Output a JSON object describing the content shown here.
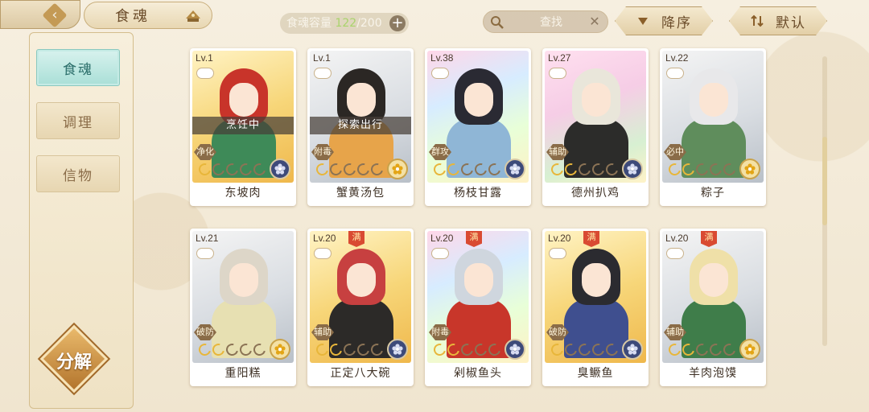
{
  "header": {
    "title": "食魂",
    "capacity_label": "食魂容量",
    "capacity_current": "122",
    "capacity_max": "/200",
    "search_placeholder": "查找",
    "sort_desc": "降序",
    "sort_default": "默认"
  },
  "sidebar": {
    "items": [
      {
        "label": "食魂",
        "active": true
      },
      {
        "label": "调理",
        "active": false
      },
      {
        "label": "信物",
        "active": false
      }
    ],
    "decompose_label": "分解"
  },
  "colors": {
    "accent": "#c49a55",
    "active_tab": "#a9dfd7",
    "status_overlay": "#463e37"
  },
  "cards": [
    {
      "level": "Lv.1",
      "name": "东坡肉",
      "role": "净化",
      "status": "烹饪中",
      "stars_on": 1,
      "badge": "blue",
      "frame": "gold",
      "hair": "#c8342a",
      "outfit": "#3e8a58",
      "ribbon": ""
    },
    {
      "level": "Lv.1",
      "name": "蟹黄汤包",
      "role": "附毒",
      "status": "探索出行",
      "stars_on": 1,
      "badge": "yellow",
      "frame": "silver",
      "hair": "#2b2724",
      "outfit": "#e7a44a",
      "ribbon": ""
    },
    {
      "level": "Lv.38",
      "name": "杨枝甘露",
      "role": "群攻",
      "status": "",
      "stars_on": 2,
      "badge": "blue",
      "frame": "rainbow",
      "hair": "#2a2a33",
      "outfit": "#8fb6d6",
      "ribbon": ""
    },
    {
      "level": "Lv.27",
      "name": "德州扒鸡",
      "role": "辅助",
      "status": "",
      "stars_on": 2,
      "badge": "blue",
      "frame": "pink",
      "hair": "#e9e6da",
      "outfit": "#2c2c2a",
      "ribbon": ""
    },
    {
      "level": "Lv.22",
      "name": "粽子",
      "role": "必中",
      "status": "",
      "stars_on": 2,
      "badge": "yellow",
      "frame": "silver",
      "hair": "#e8e8ea",
      "outfit": "#5f8d5c",
      "ribbon": ""
    },
    {
      "level": "Lv.21",
      "name": "重阳糕",
      "role": "破防",
      "status": "",
      "stars_on": 2,
      "badge": "yellow",
      "frame": "silver",
      "hair": "#ddd6c8",
      "outfit": "#e7e0b2",
      "ribbon": ""
    },
    {
      "level": "Lv.20",
      "name": "正定八大碗",
      "role": "辅助",
      "status": "",
      "stars_on": 2,
      "badge": "blue",
      "frame": "gold",
      "hair": "#c74040",
      "outfit": "#2c2a28",
      "ribbon": "满"
    },
    {
      "level": "Lv.20",
      "name": "剁椒鱼头",
      "role": "附毒",
      "status": "",
      "stars_on": 2,
      "badge": "blue",
      "frame": "rainbow",
      "hair": "#cfd6de",
      "outfit": "#c8362a",
      "ribbon": "满"
    },
    {
      "level": "Lv.20",
      "name": "臭鳜鱼",
      "role": "破防",
      "status": "",
      "stars_on": 1,
      "badge": "blue",
      "frame": "gold",
      "hair": "#2b2b30",
      "outfit": "#3f4f8f",
      "ribbon": "满"
    },
    {
      "level": "Lv.20",
      "name": "羊肉泡馍",
      "role": "辅助",
      "status": "",
      "stars_on": 2,
      "badge": "yellow",
      "frame": "silver",
      "hair": "#efe0a8",
      "outfit": "#3f7d4a",
      "ribbon": "满"
    }
  ]
}
